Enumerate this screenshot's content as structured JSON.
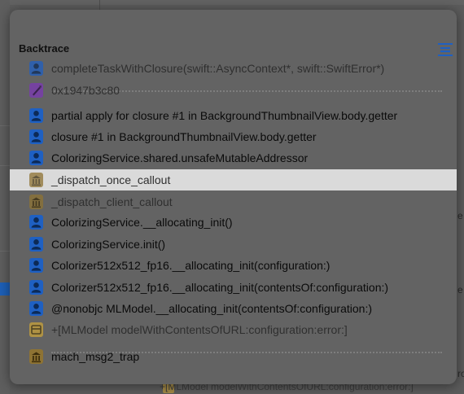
{
  "panel": {
    "title": "Backtrace"
  },
  "background": {
    "right_text_1": "e",
    "right_text_2": "e",
    "right_text_3": "ro",
    "bottom_row": "+[MLModel modelWithContentsOfURL:configuration:error:]"
  },
  "frames": [
    {
      "label": "completeTaskWithClosure(swift::AsyncContext*, swift::SwiftError*)",
      "icon": "user-icon",
      "dim": true
    },
    {
      "label": "0x1947b3c80",
      "icon": "address-icon",
      "dim": true
    },
    {
      "label": "partial apply for closure #1 in BackgroundThumbnailView.body.getter",
      "icon": "user-icon",
      "dim": false
    },
    {
      "label": "closure #1 in BackgroundThumbnailView.body.getter",
      "icon": "user-icon",
      "dim": false
    },
    {
      "label": "ColorizingService.shared.unsafeMutableAddressor",
      "icon": "user-icon",
      "dim": false
    },
    {
      "label": "_dispatch_once_callout",
      "icon": "library-icon",
      "dim": true
    },
    {
      "label": "_dispatch_client_callout",
      "icon": "library-icon",
      "dim": true
    },
    {
      "label": "ColorizingService.__allocating_init()",
      "icon": "user-icon",
      "dim": false
    },
    {
      "label": "ColorizingService.init()",
      "icon": "user-icon",
      "dim": false
    },
    {
      "label": "Colorizer512x512_fp16.__allocating_init(configuration:)",
      "icon": "user-icon",
      "dim": false
    },
    {
      "label": "Colorizer512x512_fp16.__allocating_init(contentsOf:configuration:)",
      "icon": "user-icon",
      "dim": false
    },
    {
      "label": "@nonobjc MLModel.__allocating_init(contentsOf:configuration:)",
      "icon": "user-icon",
      "dim": false
    },
    {
      "label": "+[MLModel modelWithContentsOfURL:configuration:error:]",
      "icon": "framework-icon",
      "dim": true
    },
    {
      "label": "mach_msg2_trap",
      "icon": "library-icon",
      "dim": false
    }
  ],
  "selected_index": 5,
  "colors": {
    "user_icon": "#1f60c2",
    "address_icon": "#7c37b5",
    "library_icon": "#8e7333",
    "framework_icon": "#c9a23a",
    "selection": "#dadada"
  }
}
